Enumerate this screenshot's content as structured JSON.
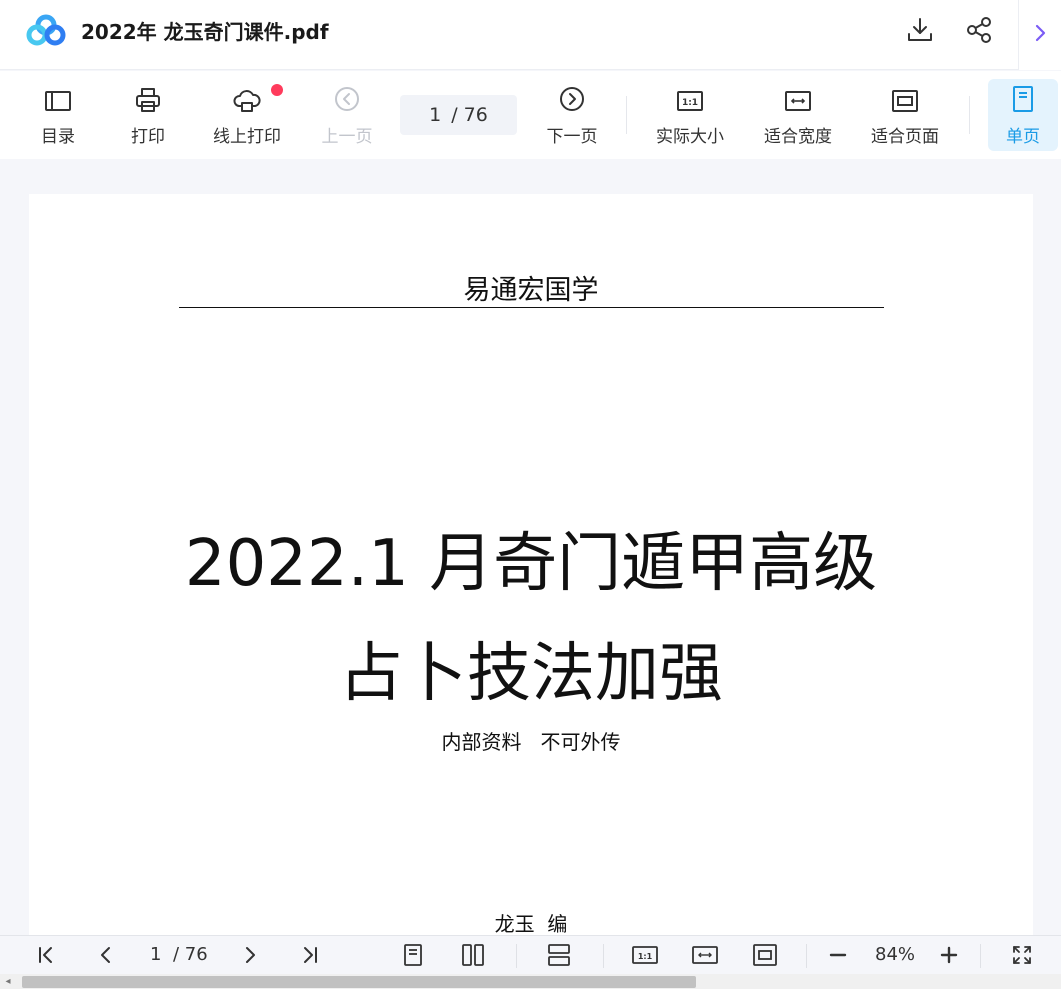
{
  "app": {
    "title": "2022年 龙玉奇门课件.pdf",
    "icons": {
      "logo": "baidu-netdisk-logo",
      "download": "download-icon",
      "share": "share-icon",
      "expand": "chevron-right-icon"
    }
  },
  "toolbar": {
    "toc_label": "目录",
    "print_label": "打印",
    "online_print_label": "线上打印",
    "prev_label": "上一页",
    "page_current": "1",
    "page_total": "/ 76",
    "next_label": "下一页",
    "actual_size_label": "实际大小",
    "fit_width_label": "适合宽度",
    "fit_page_label": "适合页面",
    "single_page_label": "单页"
  },
  "document": {
    "publisher": "易通宏国学",
    "title_line1": "2022.1 月奇门遁甲高级",
    "title_line2": "占卜技法加强",
    "subtitle": "内部资料   不可外传",
    "author": "龙玉  编"
  },
  "bottombar": {
    "page_current": "1",
    "page_total": "/ 76",
    "zoom": "84%"
  },
  "colors": {
    "accent": "#1a9be6",
    "active_bg": "#e4f3fd",
    "notification": "#ff3b5c",
    "expand_arrow": "#7b5cf5"
  }
}
